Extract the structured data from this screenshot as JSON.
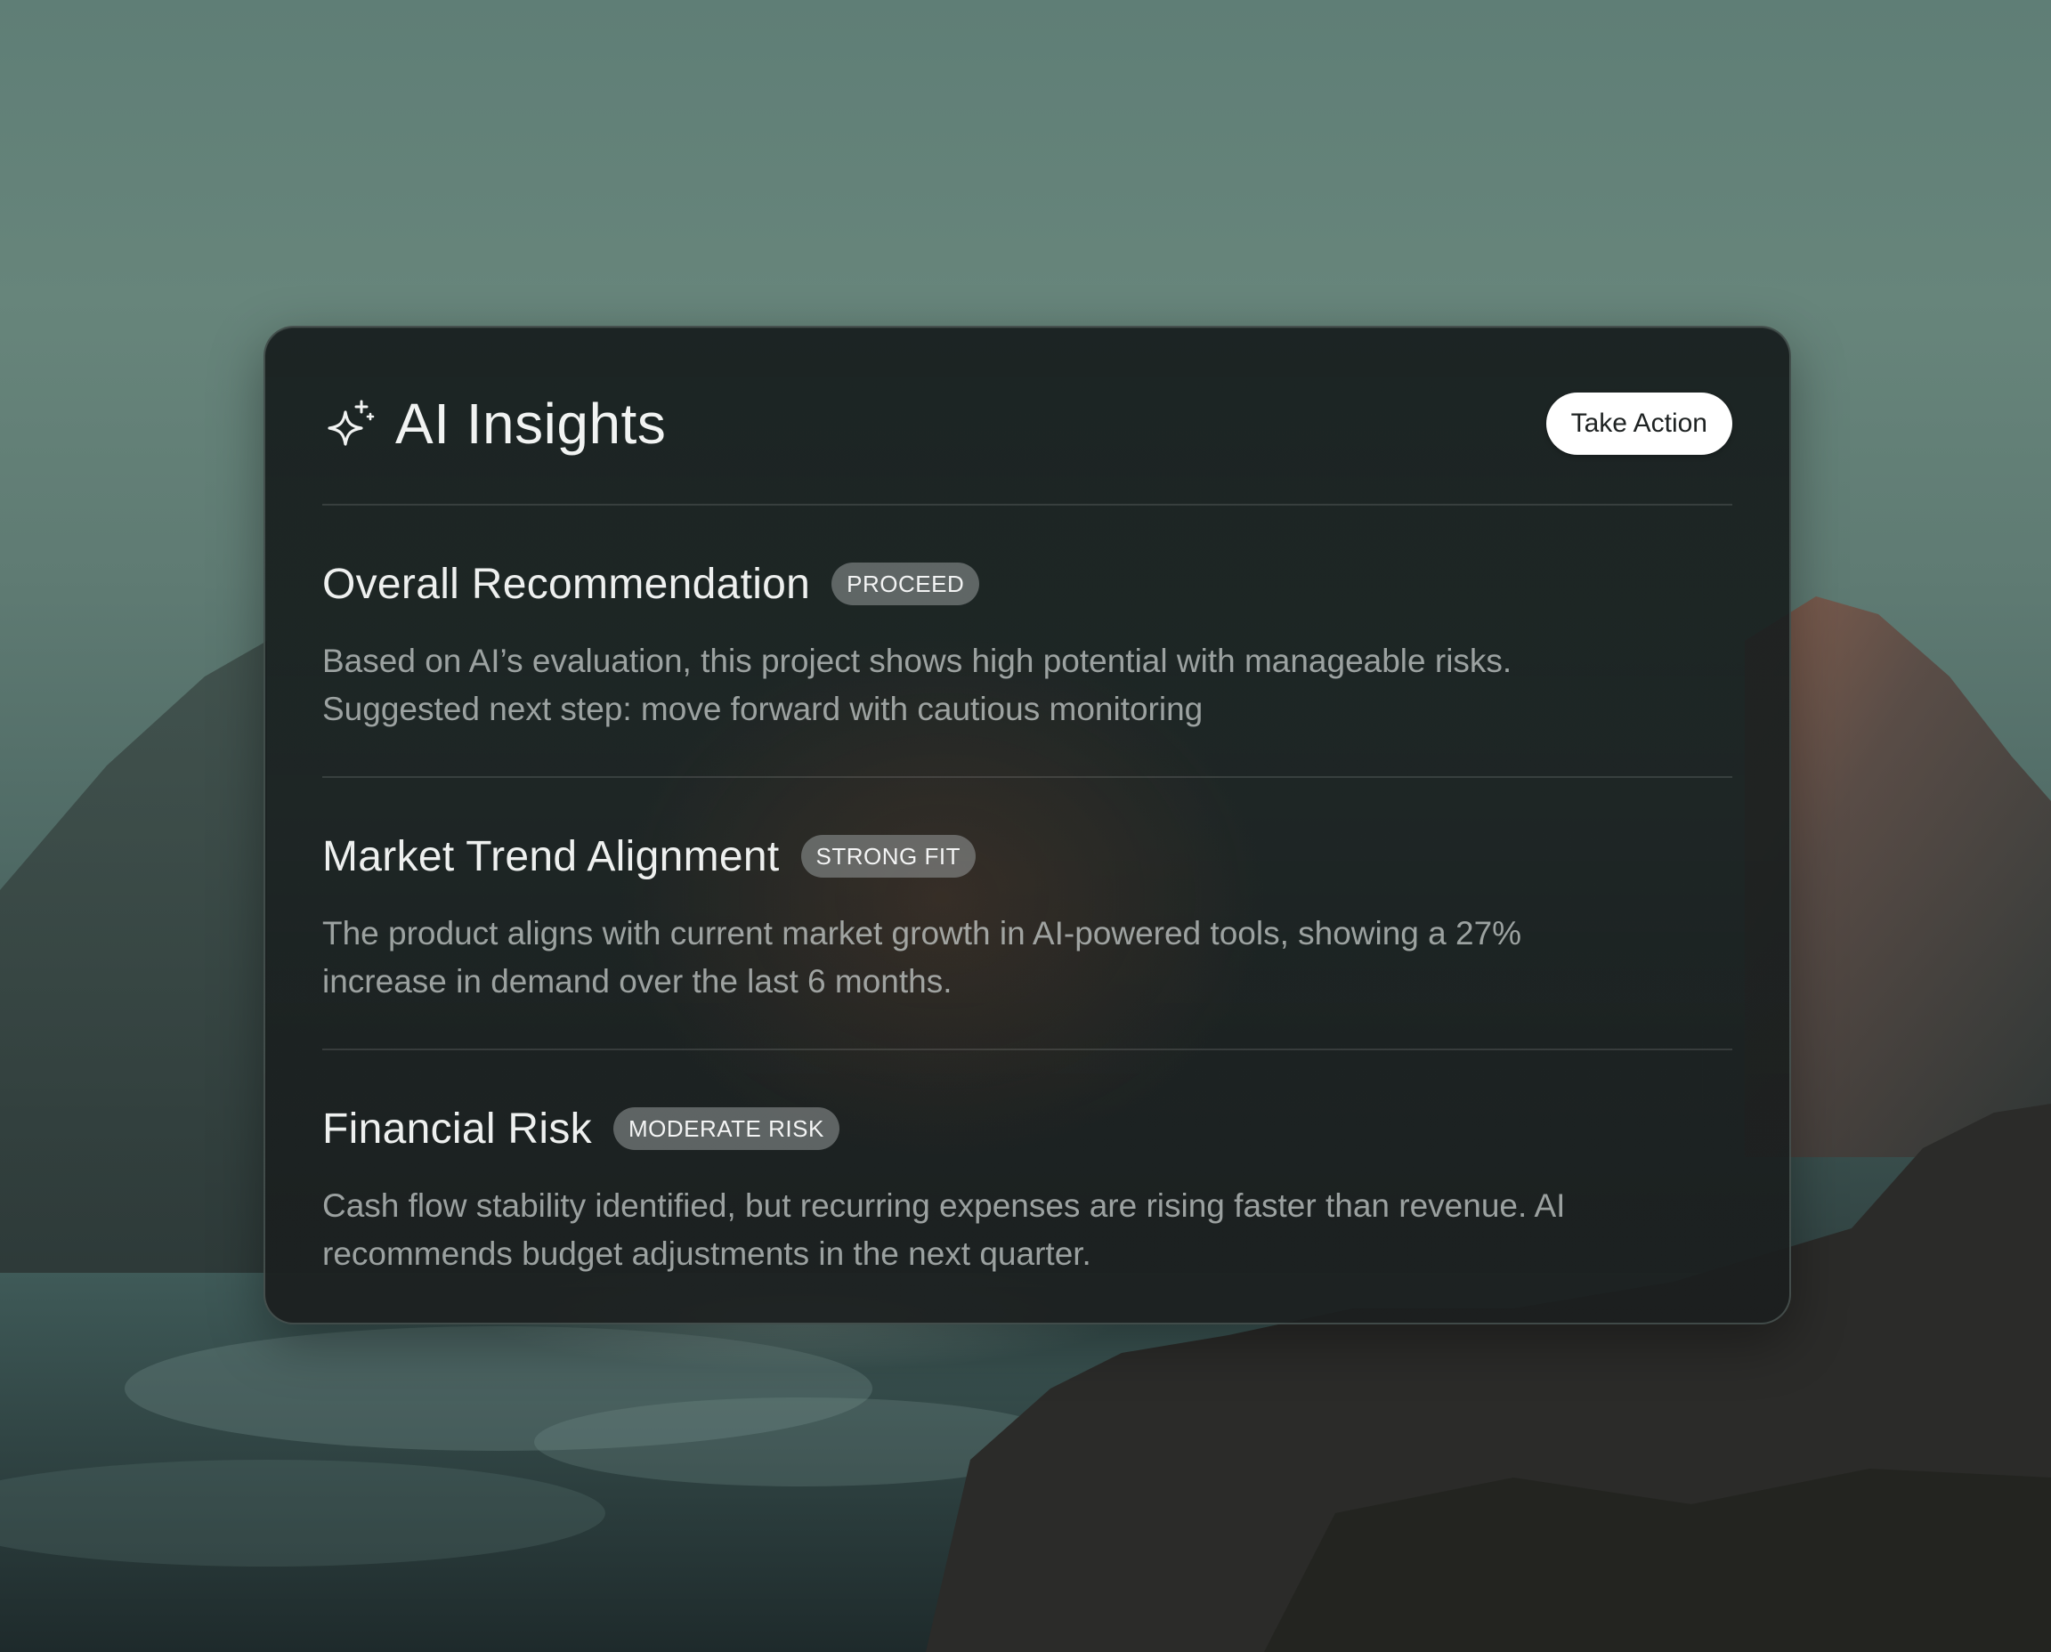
{
  "card": {
    "title": "AI Insights",
    "icon": "sparkle-icon",
    "action_label": "Take Action"
  },
  "insights": [
    {
      "title": "Overall Recommendation",
      "badge": "PROCEED",
      "body": "Based on AI’s evaluation, this project shows high potential with manageable risks. Suggested next step: move forward with cautious monitoring"
    },
    {
      "title": "Market Trend Alignment",
      "badge": "STRONG FIT",
      "body": "The product aligns with current market growth in AI-powered tools, showing a 27% increase in demand over the last 6 months."
    },
    {
      "title": "Financial Risk",
      "badge": "MODERATE RISK",
      "body": "Cash flow stability identified, but recurring expenses are rising faster than revenue. AI recommends budget adjustments in the next quarter."
    }
  ],
  "colors": {
    "card_background": "#1b2121",
    "button_background": "#ffffff",
    "badge_background": "#8a8f8f",
    "sky": "#66847a",
    "sea": "#2f4644"
  }
}
